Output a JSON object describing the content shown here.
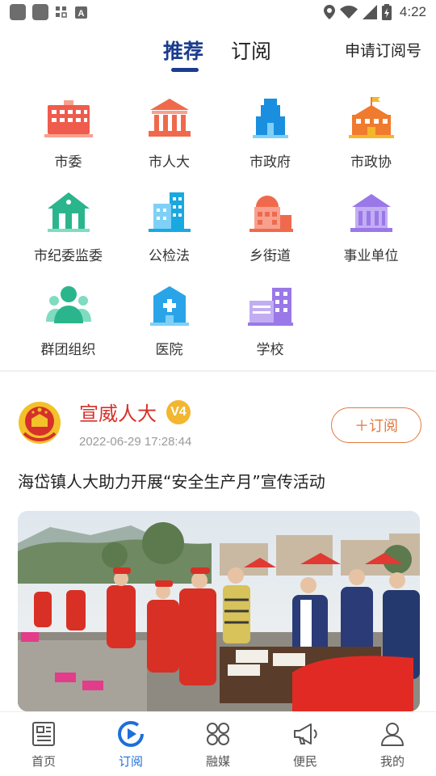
{
  "status_bar": {
    "time": "4:22",
    "left_icons": [
      "app-square-icon",
      "app-square-icon",
      "grid-icon",
      "font-a-icon"
    ],
    "right_icons": [
      "location-icon",
      "wifi-icon",
      "signal-icon",
      "battery-icon"
    ]
  },
  "top_tabs": {
    "recommended": "推荐",
    "subscribed": "订阅",
    "active": "recommended",
    "apply_label": "申请订阅号",
    "accent_color": "#1b3d8f"
  },
  "categories": [
    {
      "label": "市委",
      "icon": "building-red-icon",
      "color": "#ef5b4c"
    },
    {
      "label": "市人大",
      "icon": "pillared-hall-icon",
      "color": "#ef6a4c"
    },
    {
      "label": "市政府",
      "icon": "government-tower-icon",
      "color": "#1a8fe0"
    },
    {
      "label": "市政协",
      "icon": "flag-building-icon",
      "color": "#f07a2e"
    },
    {
      "label": "市纪委监委",
      "icon": "house-green-icon",
      "color": "#2bb58d"
    },
    {
      "label": "公检法",
      "icon": "city-buildings-icon",
      "color": "#1aa8e0"
    },
    {
      "label": "乡街道",
      "icon": "dome-building-icon",
      "color": "#ef6a4c"
    },
    {
      "label": "事业单位",
      "icon": "institution-icon",
      "color": "#9a78e8"
    },
    {
      "label": "群团组织",
      "icon": "people-group-icon",
      "color": "#2bb58d"
    },
    {
      "label": "医院",
      "icon": "hospital-icon",
      "color": "#2aa4e8"
    },
    {
      "label": "学校",
      "icon": "school-icon",
      "color": "#9a78e8"
    }
  ],
  "post": {
    "account_name": "宣威人大",
    "badge": "V4",
    "timestamp": "2022-06-29 17:28:44",
    "follow_label": "＋订阅",
    "title": "海岱镇人大助力开展“安全生产月”宣传活动",
    "name_color": "#d6302a",
    "follow_color": "#e2773e"
  },
  "bottom_nav": [
    {
      "label": "首页",
      "icon": "newspaper-icon",
      "active": false
    },
    {
      "label": "订阅",
      "icon": "subscribe-play-icon",
      "active": true
    },
    {
      "label": "融媒",
      "icon": "four-petal-icon",
      "active": false
    },
    {
      "label": "便民",
      "icon": "megaphone-icon",
      "active": false
    },
    {
      "label": "我的",
      "icon": "user-icon",
      "active": false
    }
  ]
}
